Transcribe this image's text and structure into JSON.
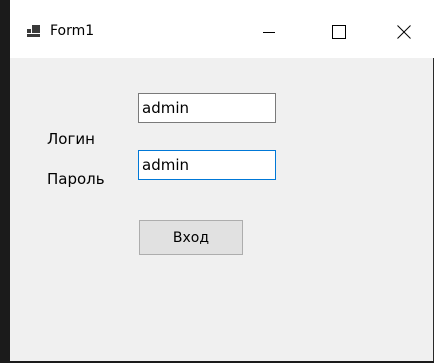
{
  "window": {
    "title": "Form1",
    "minimize_symbol": "—",
    "maximize_symbol": "☐",
    "close_symbol": "✕"
  },
  "form": {
    "login_label": "Логин",
    "login_value": "admin",
    "password_label": "Пароль",
    "password_value": "admin",
    "submit_label": "Вход"
  },
  "colors": {
    "focus_border": "#0078d7",
    "titlebar_bg": "#ffffff",
    "client_bg": "#f0f0f0",
    "button_bg": "#e1e1e1"
  },
  "icons": {
    "app": "windows-form-icon",
    "minimize": "minimize-icon",
    "maximize": "maximize-icon",
    "close": "close-icon"
  }
}
